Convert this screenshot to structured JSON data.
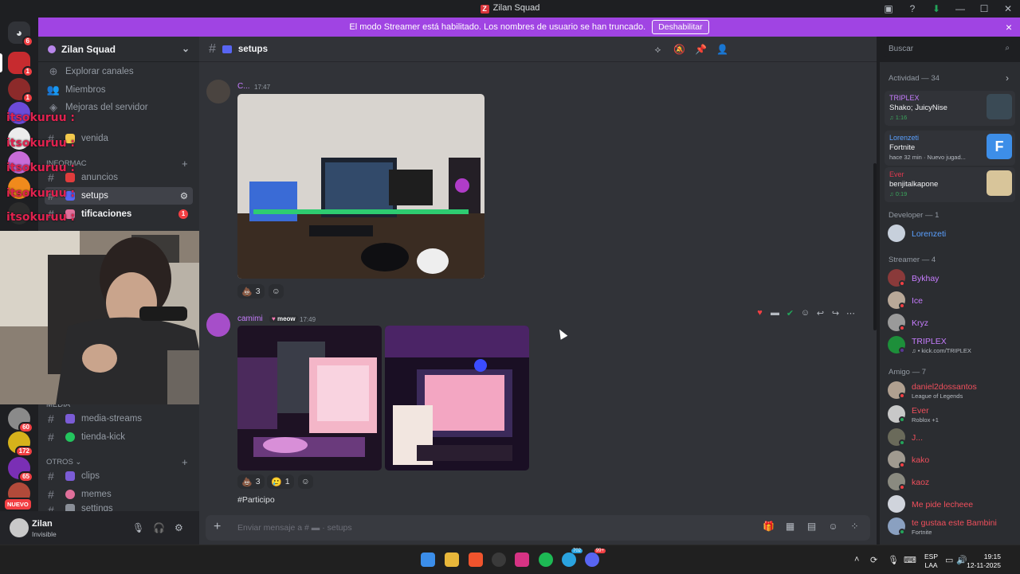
{
  "window": {
    "title": "Zilan Squad"
  },
  "banner": {
    "text": "El modo Streamer está habilitado. Los nombres de usuario se han truncado.",
    "button": "Deshabilitar",
    "close": "×"
  },
  "servers": {
    "badges": [
      "6",
      "1",
      "1",
      "60",
      "172",
      "65"
    ],
    "nuevo": "NUEVO"
  },
  "sidebar": {
    "guild_name": "Zilan Squad",
    "nav": [
      {
        "label": "Explorar canales",
        "icon": "compass-icon"
      },
      {
        "label": "Miembros",
        "icon": "members-icon"
      },
      {
        "label": "Mejoras del servidor",
        "icon": "boost-icon"
      }
    ],
    "channels_top": [
      {
        "label": "venida"
      },
      {
        "label": "anuncios"
      },
      {
        "label": "setups"
      },
      {
        "label": "tificaciones",
        "badge": "1"
      }
    ],
    "category_info": "Informac",
    "category_media": "MEDIA",
    "channels_media": [
      {
        "label": "media-streams",
        "color": "#7b5cd6"
      },
      {
        "label": "tienda-kick",
        "color": "#23c55e"
      }
    ],
    "category_otros": "OTROS",
    "channels_otros": [
      {
        "label": "clips",
        "color": "#7b5cd6"
      },
      {
        "label": "memes",
        "color": "#e0709b"
      },
      {
        "label": "settings",
        "color": "#8a8f98"
      }
    ],
    "stream_overlay": [
      "itsokuruu :",
      "itsokuruu :",
      "itsokuruu :",
      "itsokuruu :",
      "itsokuruu :"
    ]
  },
  "user": {
    "name": "Zilan",
    "status": "Invisible"
  },
  "chat": {
    "channel": "setups",
    "messages": [
      {
        "author": "C...",
        "time": "17:47",
        "reactions": [
          {
            "emoji": "💩",
            "count": "3"
          }
        ]
      },
      {
        "author": "camimi",
        "tag": "meow",
        "time": "17:49",
        "reactions": [
          {
            "emoji": "💩",
            "count": "3"
          },
          {
            "emoji": "🥲",
            "count": "1"
          }
        ]
      }
    ],
    "next_text": "#Participo",
    "composer_prefix": "Enviar mensaje a #",
    "composer_channel": "setups",
    "search_placeholder": "Buscar"
  },
  "members": {
    "activity_header": "Actividad — 34",
    "activities": [
      {
        "user": "TRIPLEX",
        "title": "Shako; JuicyNise",
        "sub": "♫ 1:16"
      },
      {
        "user": "Lorenzeti",
        "title": "Fortnite",
        "sub": "hace 32 min · Nuevo jugad..."
      },
      {
        "user": "Ever",
        "title": "benjitalkapone",
        "sub": "♫ 0:19"
      }
    ],
    "dev_header": "Developer — 1",
    "developers": [
      {
        "name": "Lorenzeti",
        "color": "#5aa0ff"
      }
    ],
    "streamer_header": "Streamer — 4",
    "streamers": [
      {
        "name": "Bykhay",
        "color": "#c77dff"
      },
      {
        "name": "Ice",
        "color": "#c77dff"
      },
      {
        "name": "Kryz",
        "color": "#c77dff"
      },
      {
        "name": "TRIPLEX",
        "color": "#c77dff",
        "activity": "♫ • kick.com/TRIPLEX"
      }
    ],
    "friends_header": "Amigo — 7",
    "friends": [
      {
        "name": "daniel2dossantos",
        "color": "#f04f5c",
        "activity": "League of Legends"
      },
      {
        "name": "Ever",
        "color": "#f04f5c",
        "activity": "Roblox +1"
      },
      {
        "name": "J...",
        "color": "#f04f5c"
      },
      {
        "name": "kako",
        "color": "#f04f5c"
      },
      {
        "name": "kaoz",
        "color": "#f04f5c"
      },
      {
        "name": "Me pide lecheee",
        "color": "#f04f5c"
      },
      {
        "name": "te gustaa este Bambini",
        "color": "#f04f5c",
        "activity": "Fortnite"
      }
    ]
  },
  "taskbar": {
    "lang1": "ESP",
    "lang2": "LAA",
    "time": "19:15",
    "date": "12-11-2025",
    "badge_telegram": "702",
    "badge_discord": "99+"
  },
  "colors": {
    "accent": "#a044e3",
    "danger": "#f23f43",
    "online": "#23a55a"
  }
}
